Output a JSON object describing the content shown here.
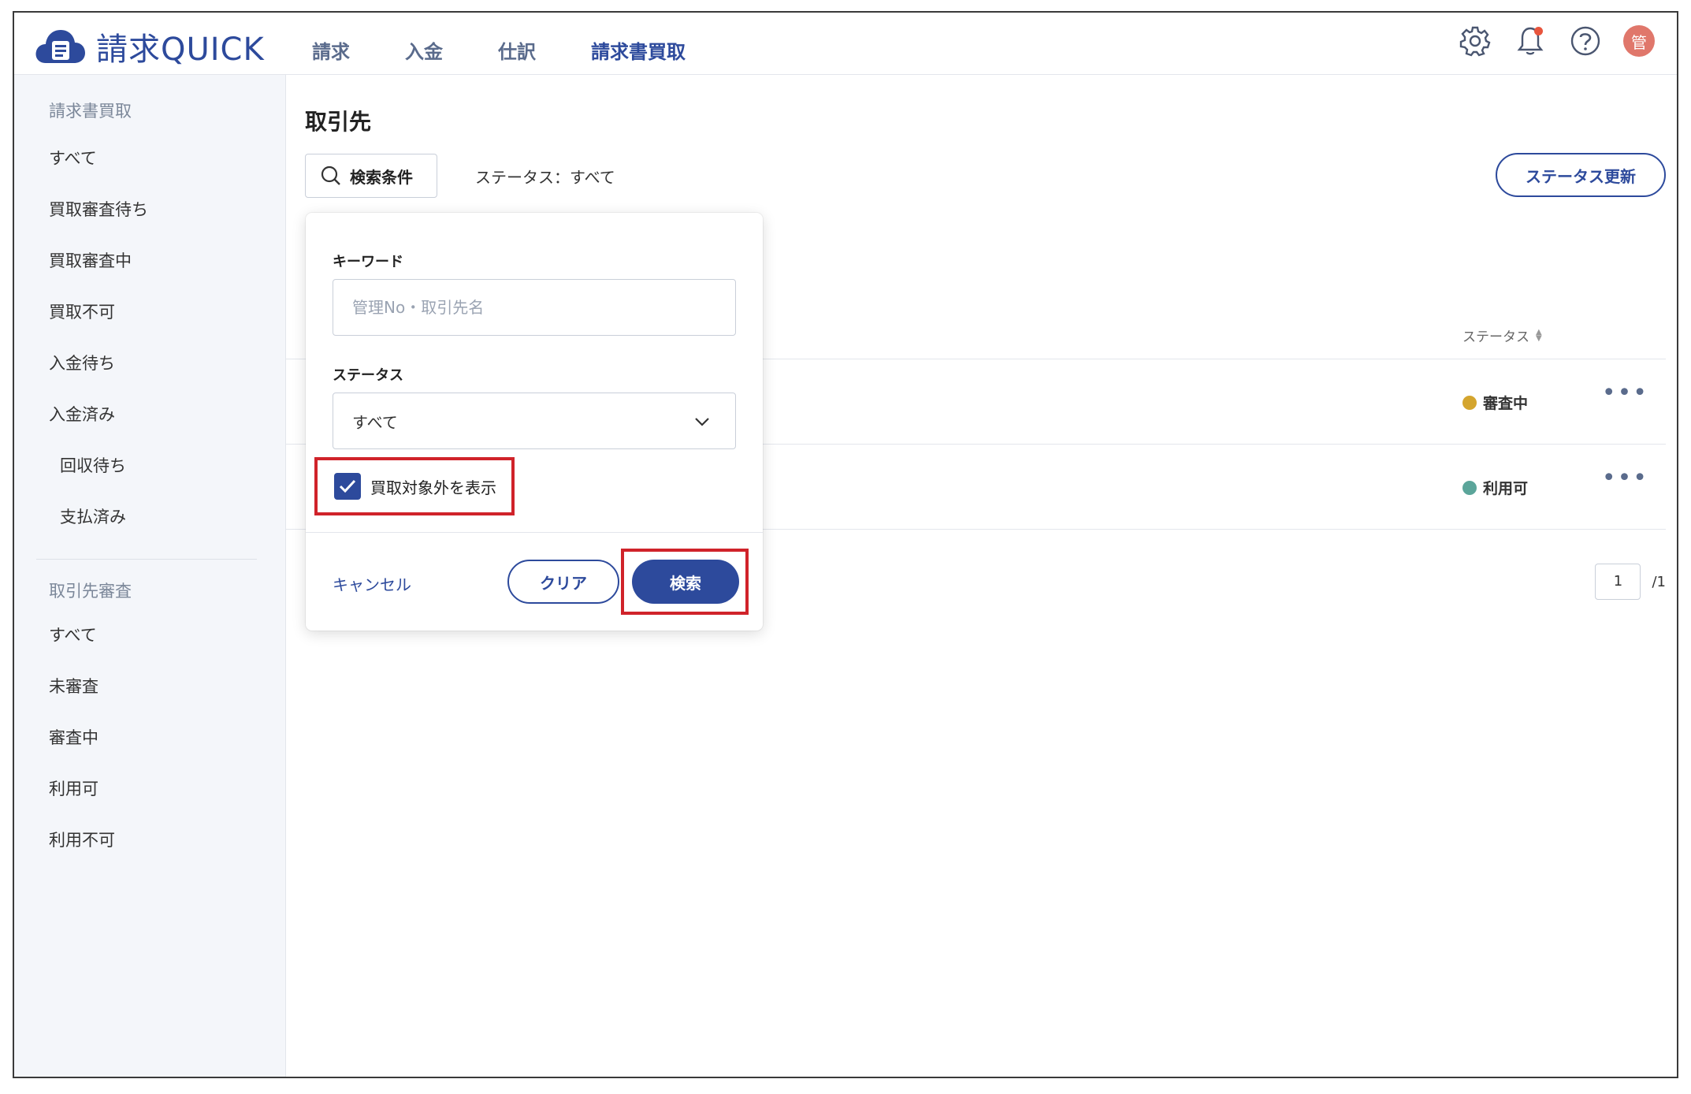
{
  "app": {
    "logo_text": "請求QUICK",
    "avatar_text": "管"
  },
  "topnav": {
    "items": [
      {
        "label": "請求",
        "active": false
      },
      {
        "label": "入金",
        "active": false
      },
      {
        "label": "仕訳",
        "active": false
      },
      {
        "label": "請求書買取",
        "active": true
      }
    ]
  },
  "header_icons": [
    "gear-icon",
    "bell-icon",
    "help-icon"
  ],
  "sidebar": {
    "section1_title": "請求書買取",
    "section1_items": [
      "すべて",
      "買取審査待ち",
      "買取審査中",
      "買取不可",
      "入金待ち",
      "入金済み"
    ],
    "section1_subitems": [
      "回収待ち",
      "支払済み"
    ],
    "section2_title": "取引先審査",
    "section2_items": [
      "すべて",
      "未審査",
      "審査中",
      "利用可",
      "利用不可"
    ]
  },
  "main": {
    "page_title": "取引先",
    "search_button_label": "検索条件",
    "status_summary": "ステータス：すべて",
    "status_update_button": "ステータス更新",
    "table": {
      "status_header": "ステータス",
      "rows": [
        {
          "status": "審査中",
          "status_color": "#d4a52e"
        },
        {
          "status": "利用可",
          "status_color": "#5ba59a"
        }
      ]
    },
    "pager": {
      "current_page": "1",
      "total": "/1"
    }
  },
  "search_popover": {
    "keyword_label": "キーワード",
    "keyword_placeholder": "管理No・取引先名",
    "keyword_value": "",
    "status_label": "ステータス",
    "status_selected": "すべて",
    "checkbox_label": "買取対象外を表示",
    "checkbox_checked": true,
    "cancel_label": "キャンセル",
    "clear_label": "クリア",
    "search_label": "検索"
  },
  "colors": {
    "brand": "#2d4a9c",
    "highlight": "#d0232a"
  }
}
